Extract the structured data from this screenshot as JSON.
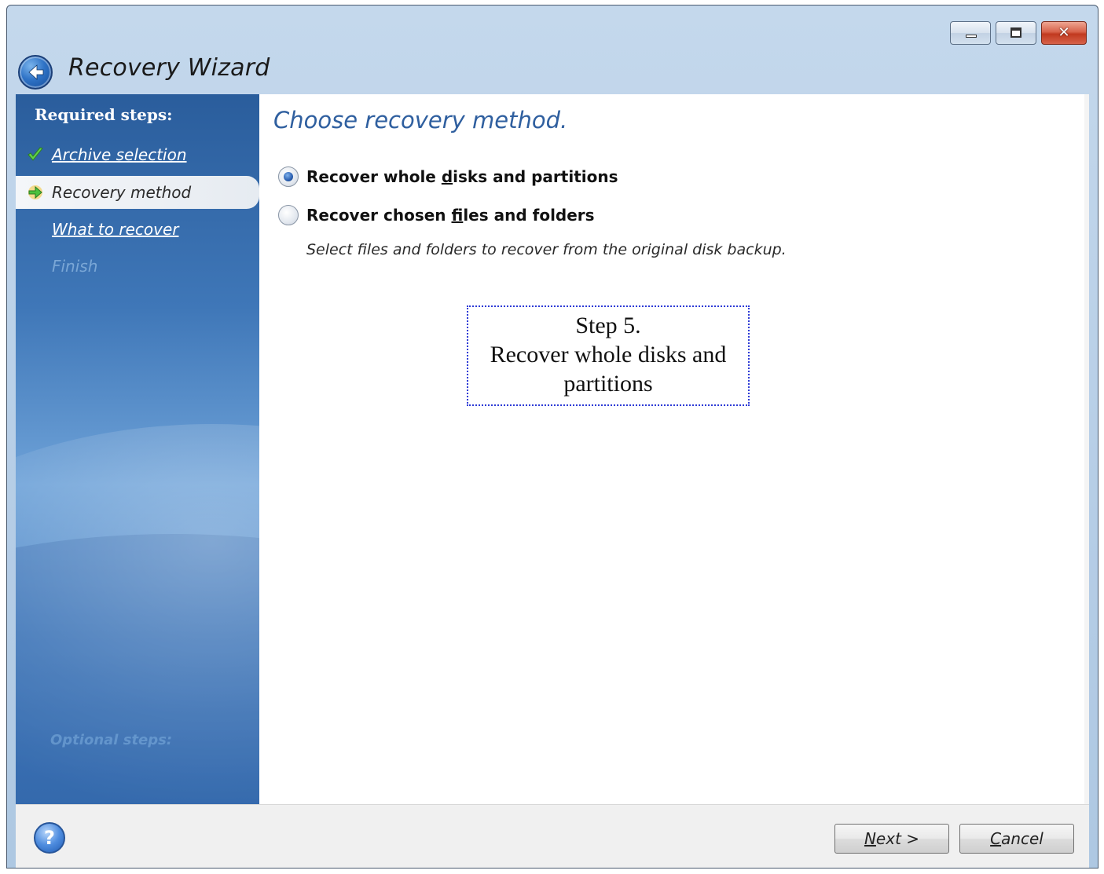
{
  "window": {
    "title": "Recovery Wizard",
    "controls": [
      "minimize-icon",
      "maximize-icon",
      "close-icon"
    ]
  },
  "sidebar": {
    "heading": "Required steps:",
    "steps": [
      {
        "label": "Archive selection",
        "state": "done",
        "icon": "checkmark-icon"
      },
      {
        "label": "Recovery method",
        "state": "current",
        "icon": "arrow-right-icon"
      },
      {
        "label": "What to recover",
        "state": "link"
      },
      {
        "label": "Finish",
        "state": "disabled"
      }
    ],
    "optional_heading": "Optional steps:"
  },
  "main": {
    "title": "Choose recovery method.",
    "options": [
      {
        "label_parts": [
          "Recover whole ",
          "d",
          "isks and partitions"
        ],
        "checked": true
      },
      {
        "label_parts": [
          "Recover chosen ",
          "f",
          "iles and folders"
        ],
        "checked": false
      }
    ],
    "option_description": "Select files and folders to recover from the original disk backup.",
    "annotation": [
      "Step 5.",
      "Recover whole disks and",
      "partitions"
    ]
  },
  "footer": {
    "help_icon": "help-icon",
    "help_glyph": "?",
    "next_parts": [
      "N",
      "ext >"
    ],
    "cancel_parts": [
      "C",
      "ancel"
    ]
  },
  "colors": {
    "sidebar_blue": "#3f77b8",
    "title_blue": "#2f5f9f",
    "annotation_border": "#2e3bd6"
  }
}
